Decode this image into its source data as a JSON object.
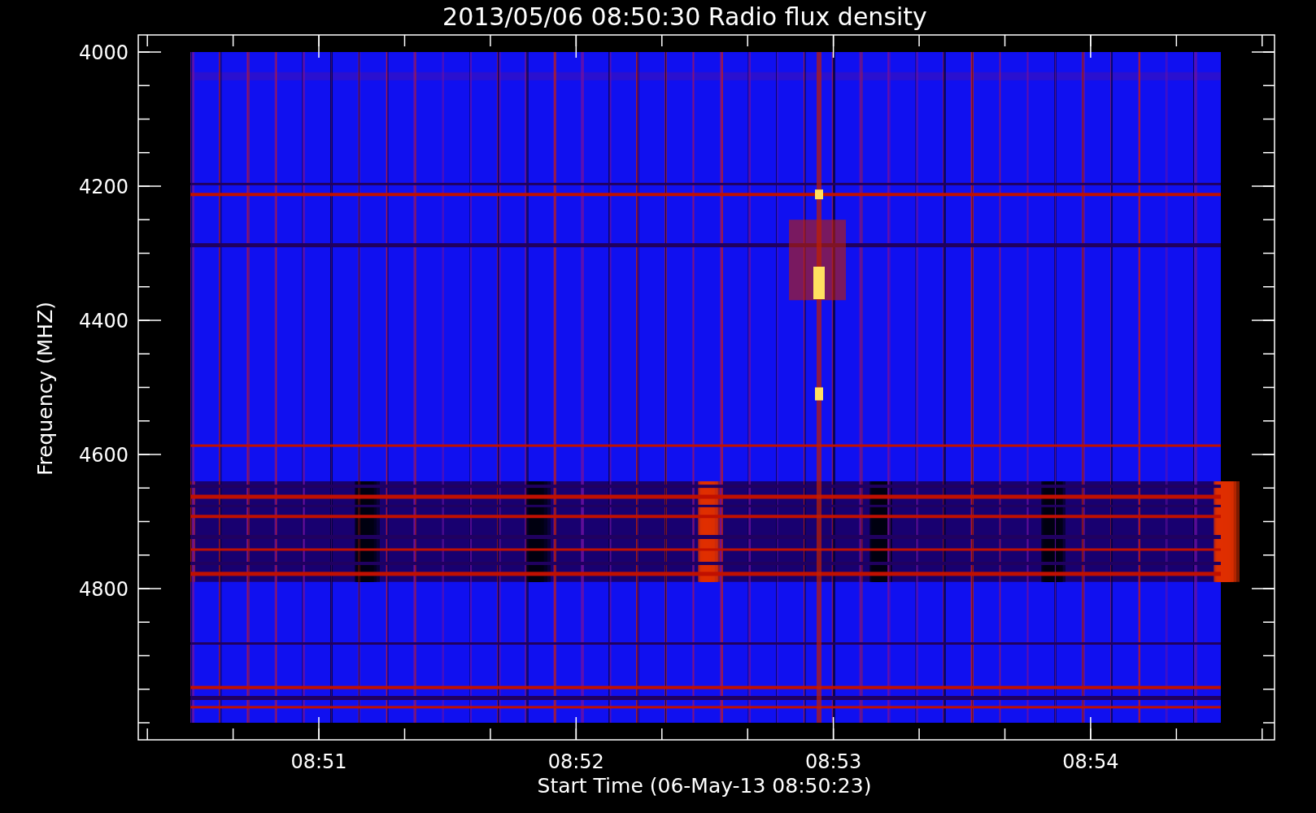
{
  "title": "2013/05/06 08:50:30 Radio flux density",
  "y_axis": {
    "label": "Frequency (MHZ)",
    "ticks": [
      "4000",
      "4200",
      "4400",
      "4600",
      "4800"
    ]
  },
  "x_axis": {
    "label": "Start Time (06-May-13 08:50:23)",
    "ticks": [
      "08:51",
      "08:52",
      "08:53",
      "08:54"
    ]
  }
}
